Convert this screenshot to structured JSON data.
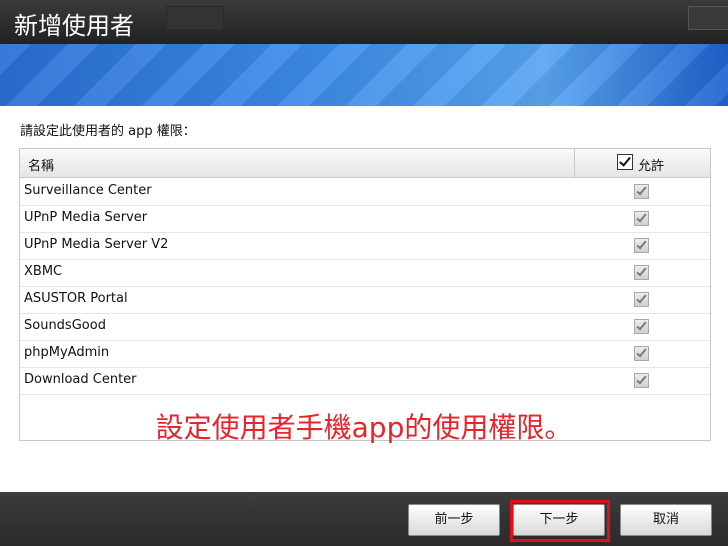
{
  "dialog": {
    "title": "新增使用者",
    "prompt": "請設定此使用者的 app 權限：",
    "columns": {
      "name": "名稱",
      "allow": "允許"
    },
    "rows": [
      {
        "name": "Surveillance Center",
        "allowed": true
      },
      {
        "name": "UPnP Media Server",
        "allowed": true
      },
      {
        "name": "UPnP Media Server V2",
        "allowed": true
      },
      {
        "name": "XBMC",
        "allowed": true
      },
      {
        "name": "ASUSTOR Portal",
        "allowed": true
      },
      {
        "name": "SoundsGood",
        "allowed": true
      },
      {
        "name": "phpMyAdmin",
        "allowed": true
      },
      {
        "name": "Download Center",
        "allowed": true
      }
    ]
  },
  "annotation": "設定使用者手機app的使用權限。",
  "footer": {
    "prev_label": "前一步",
    "next_label": "下一步",
    "cancel_label": "取消"
  },
  "colors": {
    "annotation": "#e8232a",
    "highlight": "#e0101a",
    "banner": "#3f8eea"
  }
}
